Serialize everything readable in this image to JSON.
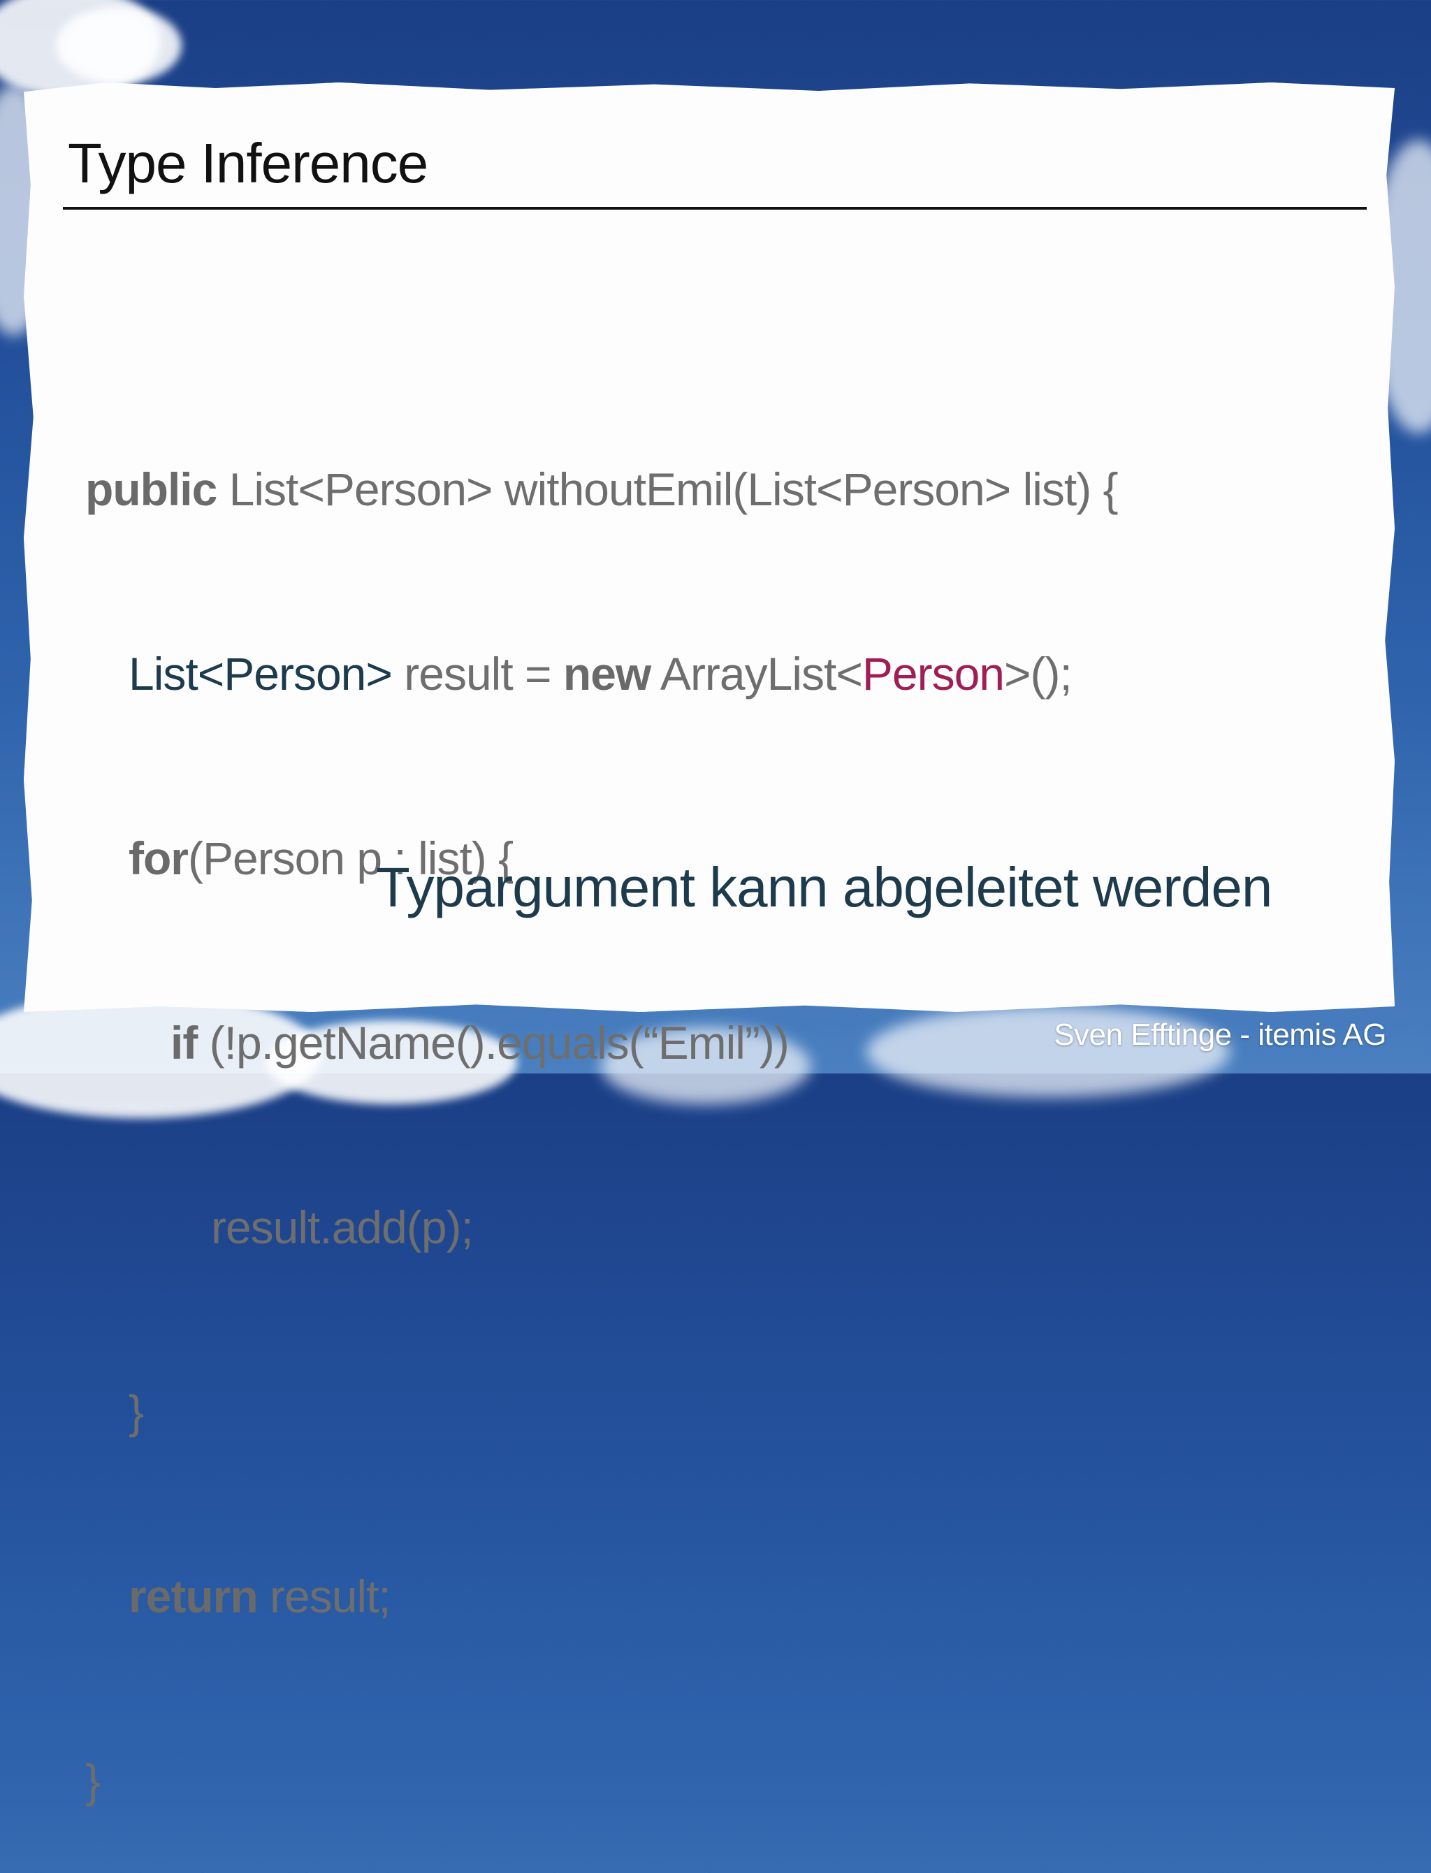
{
  "slide": {
    "title": "Type Inference",
    "note": "Typargument kann abgeleitet werden",
    "footer": "Sven Efftinge - itemis AG"
  },
  "code": {
    "l1_kw": "public",
    "l1_rest": " List<Person> withoutEmil(List<Person> list) {",
    "l2_a": "List<Person>",
    "l2_b": " result = ",
    "l2_kw": "new",
    "l2_c": " ArrayList<",
    "l2_accent": "Person",
    "l2_d": ">();",
    "l3_kw": "for",
    "l3_rest": "(Person p : list) {",
    "l4_kw": "if",
    "l4_rest": " (!p.getName().equals(“Emil”))",
    "l5": "result.add(p);",
    "l6": "}",
    "l7_kw": "return",
    "l7_rest": " result;",
    "l8": "}"
  },
  "colors": {
    "accent": "#a01e55",
    "dark_text": "#1d3b4c",
    "code_text": "#6e6e6e",
    "sky": "#24519c"
  }
}
